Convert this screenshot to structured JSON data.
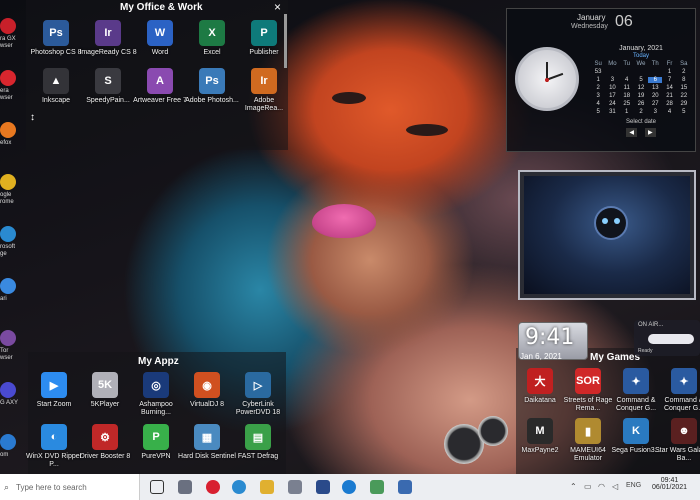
{
  "office_fence": {
    "title": "My Office & Work",
    "close": "×",
    "icons": [
      {
        "label": "Photoshop CS 8",
        "glyph": "Ps",
        "color": "#2b5a9a"
      },
      {
        "label": "ImageReady CS 8",
        "glyph": "Ir",
        "color": "#5a3a8a"
      },
      {
        "label": "Word",
        "glyph": "W",
        "color": "#2b62c4"
      },
      {
        "label": "Excel",
        "glyph": "X",
        "color": "#1d7a44"
      },
      {
        "label": "Publisher",
        "glyph": "P",
        "color": "#0e7a7a"
      },
      {
        "label": "Inkscape",
        "glyph": "▲",
        "color": "#333338"
      },
      {
        "label": "SpeedyPain...",
        "glyph": "S",
        "color": "#3a3a40"
      },
      {
        "label": "Artweaver Free 7",
        "glyph": "A",
        "color": "#8a4ab0"
      },
      {
        "label": "Adobe Photosh...",
        "glyph": "Ps",
        "color": "#3a7ab8"
      },
      {
        "label": "Adobe ImageRea...",
        "glyph": "Ir",
        "color": "#d06a20"
      }
    ],
    "resize_glyph": "↕"
  },
  "left_column": [
    {
      "label": "ra GX wser",
      "color": "#c8202a"
    },
    {
      "label": "era wser",
      "color": "#d8262e"
    },
    {
      "label": "efox",
      "color": "#e87820"
    },
    {
      "label": "ogle rome",
      "color": "#e0b020"
    },
    {
      "label": "rosoft ge",
      "color": "#2a8ad0"
    },
    {
      "label": "ari",
      "color": "#3a8ae0"
    },
    {
      "label": "Tor wser",
      "color": "#7a4aa0"
    },
    {
      "label": "G AXY",
      "color": "#4a4ad0"
    },
    {
      "label": "om",
      "color": "#2a7ad0"
    }
  ],
  "appz_fence": {
    "title": "My Appz",
    "icons": [
      {
        "label": "Start Zoom",
        "glyph": "▶",
        "color": "#2d8cf0"
      },
      {
        "label": "5KPlayer",
        "glyph": "5K",
        "color": "#b0b0b8"
      },
      {
        "label": "Ashampoo Burning...",
        "glyph": "◎",
        "color": "#1a3a7a"
      },
      {
        "label": "VirtualDJ 8",
        "glyph": "◉",
        "color": "#d05020"
      },
      {
        "label": "CyberLink PowerDVD 18",
        "glyph": "▷",
        "color": "#2a6aa0"
      },
      {
        "label": "WinX DVD Ripper P...",
        "glyph": "◐",
        "color": "#2a8ae0"
      },
      {
        "label": "Driver Booster 8",
        "glyph": "⚙",
        "color": "#c02828"
      },
      {
        "label": "PureVPN",
        "glyph": "P",
        "color": "#38b04a"
      },
      {
        "label": "Hard Disk Sentinel",
        "glyph": "▦",
        "color": "#4a8ac0"
      },
      {
        "label": "FAST Defrag",
        "glyph": "▤",
        "color": "#3aa048"
      }
    ]
  },
  "games_fence": {
    "title": "My Games",
    "icons": [
      {
        "label": "Daikatana",
        "glyph": "大",
        "color": "#c02020"
      },
      {
        "label": "Streets of Rage Rema...",
        "glyph": "SOR",
        "color": "#d02828"
      },
      {
        "label": "Command & Conquer G...",
        "glyph": "✦",
        "color": "#2a5aa0"
      },
      {
        "label": "Command & Conquer G...",
        "glyph": "✦",
        "color": "#2a5aa0"
      },
      {
        "label": "MaxPayne2",
        "glyph": "M",
        "color": "#2a2a2a"
      },
      {
        "label": "MAMEUI64 Emulator",
        "glyph": "▮",
        "color": "#b08a30"
      },
      {
        "label": "Sega Fusion3...",
        "glyph": "K",
        "color": "#2a7ac0"
      },
      {
        "label": "Star Wars Galactic Ba...",
        "glyph": "☻",
        "color": "#5a2020"
      }
    ]
  },
  "calendar_gadget": {
    "month": "January",
    "weekday_day": "Wednesday",
    "day_num": "06",
    "header": "January, 2021",
    "today_label": "Today",
    "weekdays": [
      "Su",
      "Mo",
      "Tu",
      "We",
      "Th",
      "Fr",
      "Sa"
    ],
    "rows": [
      [
        "53",
        "",
        "",
        "",
        "",
        "1",
        "2"
      ],
      [
        "1",
        "3",
        "4",
        "5",
        "6",
        "7",
        "8"
      ],
      [
        "2",
        "10",
        "11",
        "12",
        "13",
        "14",
        "15"
      ],
      [
        "3",
        "17",
        "18",
        "19",
        "20",
        "21",
        "22"
      ],
      [
        "4",
        "24",
        "25",
        "26",
        "27",
        "28",
        "29"
      ],
      [
        "5",
        "31",
        "1",
        "2",
        "3",
        "4",
        "5"
      ]
    ],
    "select_date": "Select date",
    "prev": "◀",
    "next": "▶"
  },
  "clock_gadget": {
    "time": "9:41",
    "date": "Jan 6, 2021"
  },
  "weather_gadget": {
    "title": "ON AIR...",
    "status": "Ready"
  },
  "taskbar": {
    "search_placeholder": "Type here to search",
    "time": "09:41",
    "date": "06/01/2021"
  }
}
